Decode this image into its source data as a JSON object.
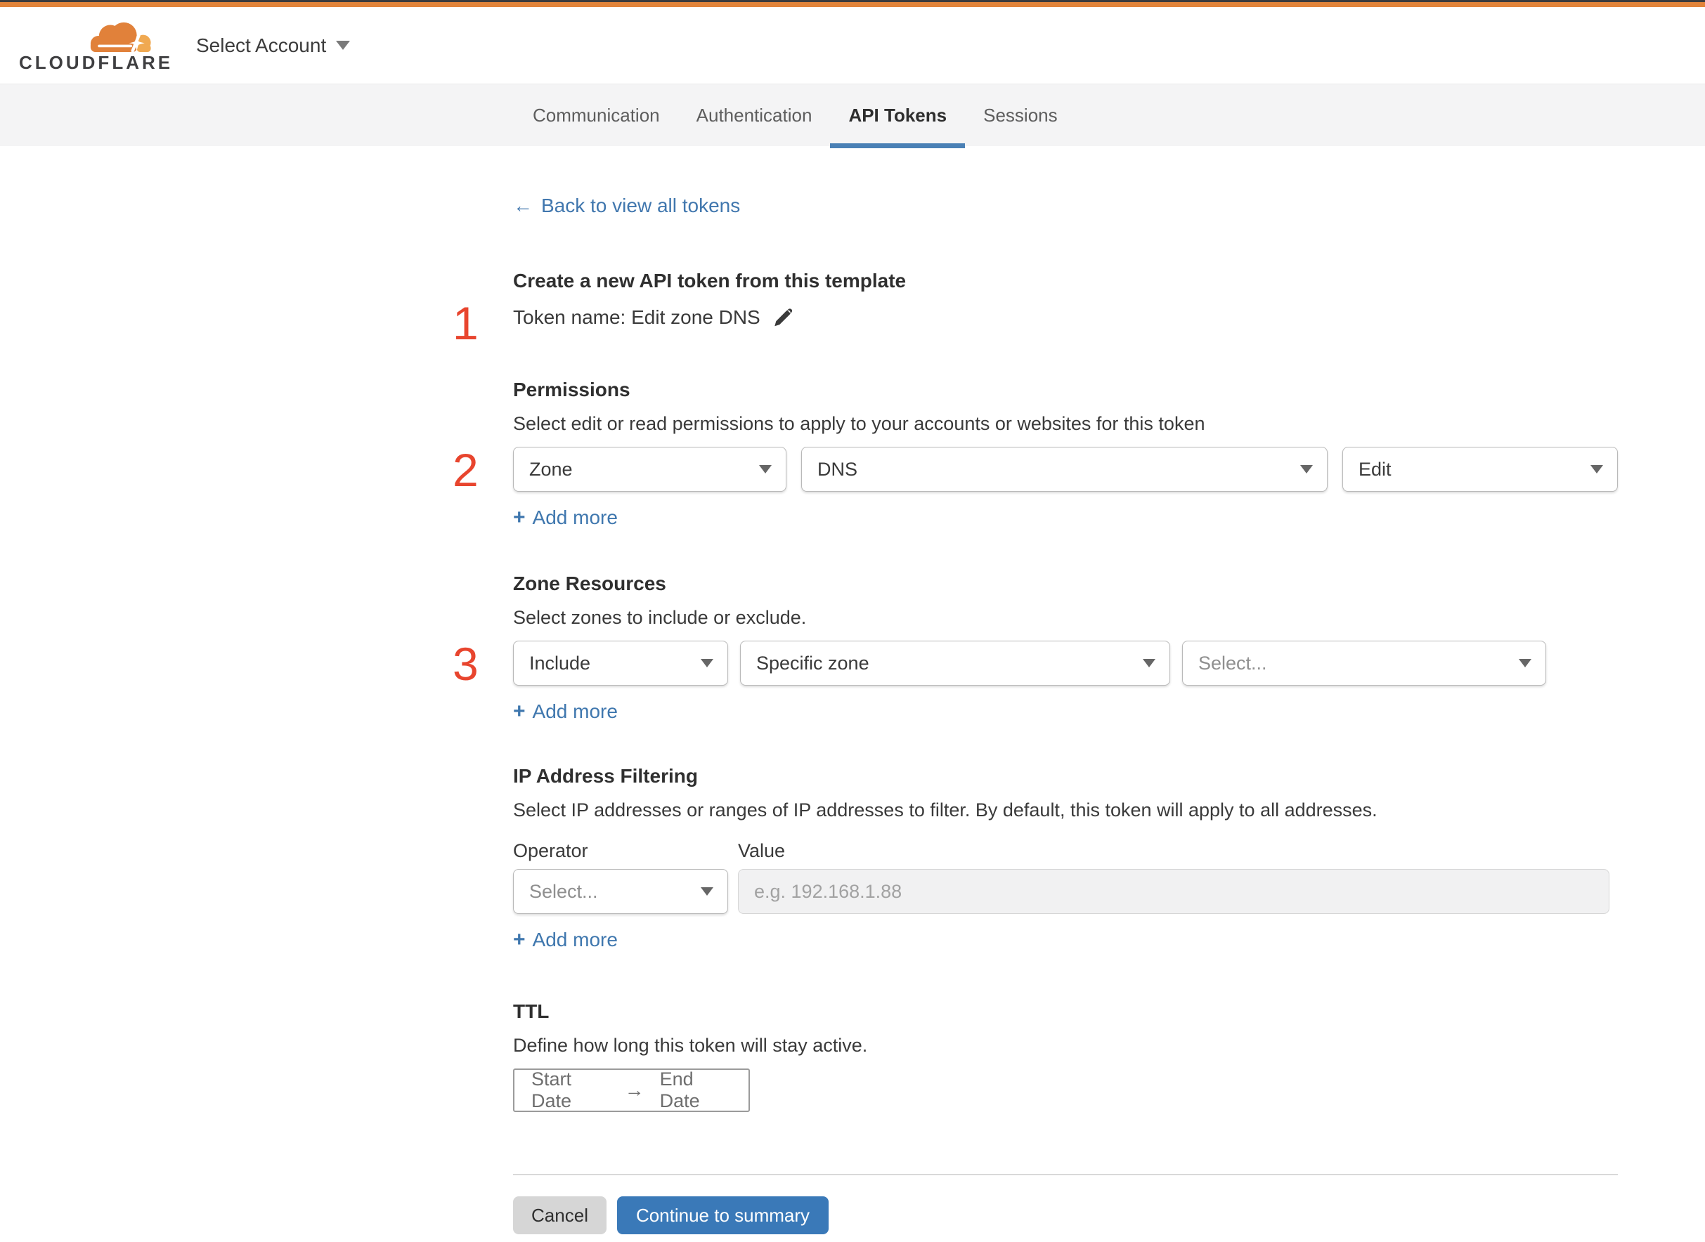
{
  "ui": {
    "plus": "+",
    "back_arrow": "←",
    "range_arrow": "→"
  },
  "header": {
    "logo_text": "CLOUDFLARE",
    "account_selector": "Select Account"
  },
  "tabs": {
    "active": "API Tokens",
    "items": [
      {
        "label": "Communication"
      },
      {
        "label": "Authentication"
      },
      {
        "label": "API Tokens"
      },
      {
        "label": "Sessions"
      }
    ]
  },
  "back_link": {
    "label": "Back to view all tokens"
  },
  "token": {
    "step": "1",
    "title": "Create a new API token from this template",
    "name_line": "Token name: Edit zone DNS"
  },
  "permissions": {
    "step": "2",
    "title": "Permissions",
    "description": "Select edit or read permissions to apply to your accounts or websites for this token",
    "scope": "Zone",
    "service": "DNS",
    "access": "Edit",
    "add_more": "Add more"
  },
  "zone_resources": {
    "step": "3",
    "title": "Zone Resources",
    "description": "Select zones to include or exclude.",
    "mode": "Include",
    "type": "Specific zone",
    "zone_placeholder": "Select...",
    "add_more": "Add more"
  },
  "ip_filtering": {
    "title": "IP Address Filtering",
    "description": "Select IP addresses or ranges of IP addresses to filter. By default, this token will apply to all addresses.",
    "operator_label": "Operator",
    "value_label": "Value",
    "operator_placeholder": "Select...",
    "value_placeholder": "e.g. 192.168.1.88",
    "add_more": "Add more"
  },
  "ttl": {
    "title": "TTL",
    "description": "Define how long this token will stay active.",
    "start": "Start Date",
    "end": "End Date"
  },
  "footer": {
    "cancel": "Cancel",
    "continue": "Continue to summary"
  },
  "colors": {
    "accent_orange": "#e2843a",
    "link_blue": "#4177ae",
    "button_blue": "#3a79b8",
    "step_red": "#e8452e",
    "tab_underline": "#4a80b5",
    "cancel_gray": "#d6d6d6"
  }
}
